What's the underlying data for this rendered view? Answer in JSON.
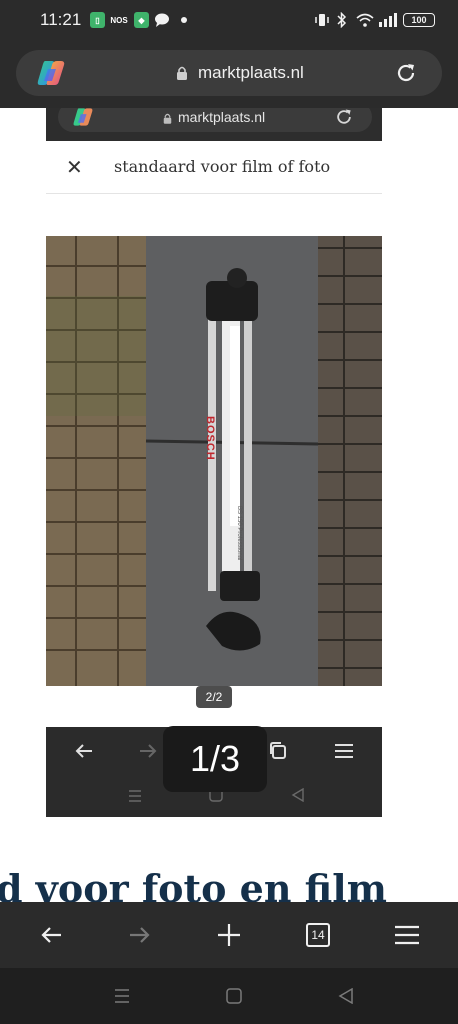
{
  "status_bar": {
    "time": "11:21",
    "nos_label": "NOS",
    "battery": "100"
  },
  "browser": {
    "url": "marktplaats.nl"
  },
  "page": {
    "inner_url": "marktplaats.nl",
    "search_query": "standaard voor film of foto",
    "image_counter": "2/2",
    "page_indicator": "1/3",
    "heading_fragment": "d voor foto en film"
  },
  "photo": {
    "brand_text": "BOSCH",
    "model_text": "BS 150 Professional"
  },
  "toolbar": {
    "tab_count": "14"
  },
  "colors": {
    "chrome_dark": "#2b2b2b",
    "heading_blue": "#15304a"
  }
}
